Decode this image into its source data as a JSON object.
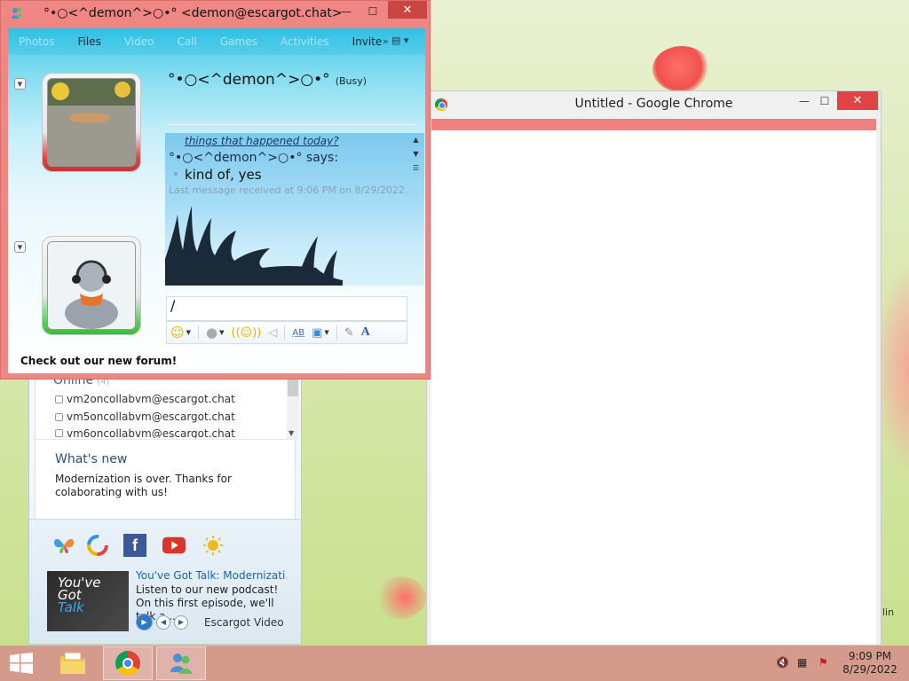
{
  "messenger": {
    "title": "°•○<^demon^>○•° <demon@escargot.chat>",
    "window_controls": {
      "minimize": "—",
      "maximize": "☐",
      "close": "✕"
    },
    "tabs": [
      "Photos",
      "Files",
      "Video",
      "Call",
      "Games",
      "Activities",
      "Invite"
    ],
    "tabs_more": "»",
    "contact_name": "°•○<^demon^>○•°",
    "contact_status": "(Busy)",
    "history": {
      "topic": "things that happened today?",
      "sender_line": "°•○<^demon^>○•° says:",
      "message": "kind of, yes",
      "last_received": "Last message received at 9:06 PM on 8/29/2022."
    },
    "input_value": "/",
    "footer_link": "Check out our new forum!",
    "colors": {
      "window_frame": "#f08683",
      "accent": "#2fc1e4"
    }
  },
  "contact_list": {
    "online_label": "Online",
    "online_count": "(4)",
    "contacts": [
      "vm2oncollabvm@escargot.chat",
      "vm5oncollabvm@escargot.chat",
      "vm6oncollabvm@escargot.chat"
    ],
    "whats_new_title": "What's new",
    "whats_new_text": "Modernization is over. Thanks for colaborating with us!",
    "video": {
      "thumb_line1": "You've",
      "thumb_line2": "Got",
      "thumb_line3": "Talk",
      "title": "You've Got Talk: Modernizati...",
      "description": "Listen to our new podcast! On this first episode, we'll talk a...",
      "source": "Escargot Video"
    }
  },
  "chrome": {
    "title": "Untitled - Google Chrome",
    "window_controls": {
      "minimize": "—",
      "maximize": "☐",
      "close": "✕"
    }
  },
  "desktop_text": "lin",
  "taskbar": {
    "time": "9:09 PM",
    "date": "8/29/2022"
  }
}
